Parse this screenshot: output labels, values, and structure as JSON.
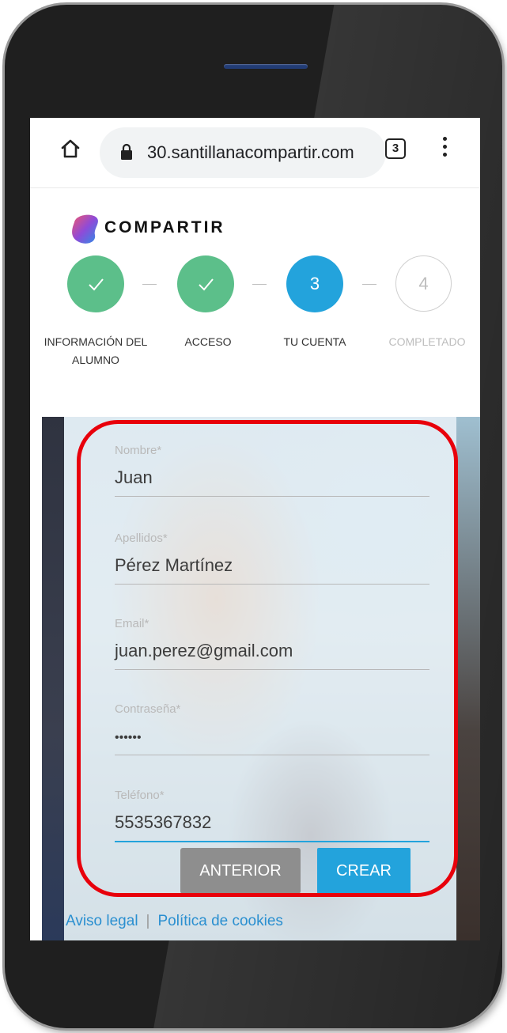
{
  "browser": {
    "url": "30.santillanacompartir.com",
    "tab_count": "3",
    "icons": [
      "home-icon",
      "lock-icon",
      "tabs-icon",
      "more-vert-icon"
    ]
  },
  "brand": {
    "logo_text": "COMPARTIR",
    "colors": {
      "accent": "#23a3dc",
      "done": "#5cbf8a",
      "highlight": "#e8000b"
    }
  },
  "steps": [
    {
      "number": "",
      "label_line1": "INFORMACIÓN DEL",
      "label_line2": "ALUMNO",
      "state": "done"
    },
    {
      "number": "",
      "label_line1": "ACCESO",
      "label_line2": "",
      "state": "done"
    },
    {
      "number": "3",
      "label_line1": "TU CUENTA",
      "label_line2": "",
      "state": "active"
    },
    {
      "number": "4",
      "label_line1": "COMPLETADO",
      "label_line2": "",
      "state": "pending"
    }
  ],
  "form": {
    "fields": [
      {
        "label": "Nombre*",
        "value": "Juan"
      },
      {
        "label": "Apellidos*",
        "value": "Pérez Martínez"
      },
      {
        "label": "Email*",
        "value": "juan.perez@gmail.com"
      },
      {
        "label": "Contraseña*",
        "value": "••••••"
      },
      {
        "label": "Teléfono*",
        "value": "5535367832"
      }
    ],
    "prev_label": "ANTERIOR",
    "create_label": "CREAR"
  },
  "footer": {
    "legal": "Aviso legal",
    "cookies": "Política de cookies"
  }
}
